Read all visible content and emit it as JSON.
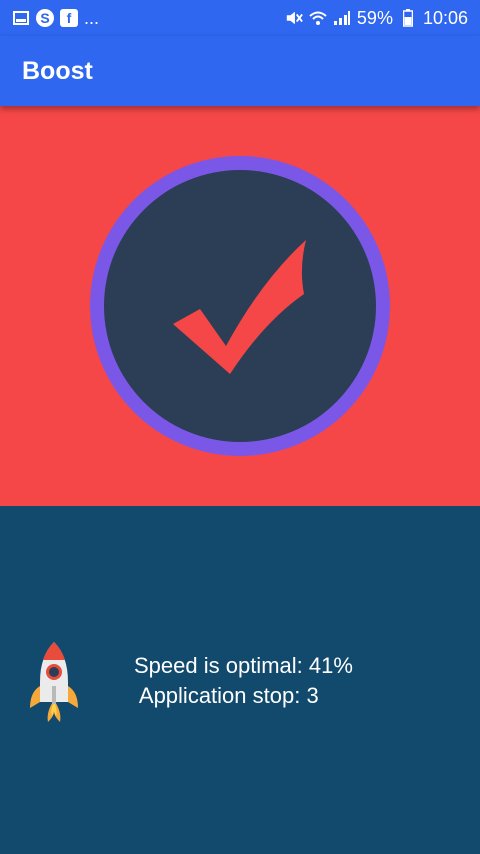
{
  "status_bar": {
    "notifications": [
      "gallery-icon",
      "skype-icon",
      "facebook-icon"
    ],
    "more": "...",
    "battery": "59%",
    "time": "10:06"
  },
  "app_bar": {
    "title": "Boost"
  },
  "hero": {
    "icon": "checkmark-icon",
    "background_color": "#f54747",
    "ring_color": "#7b57e8",
    "circle_color": "#2c3e55"
  },
  "info": {
    "icon": "rocket-icon",
    "speed_text": "Speed is optimal: 41%",
    "stop_text": " Application stop: 3",
    "background_color": "#124a6e"
  }
}
